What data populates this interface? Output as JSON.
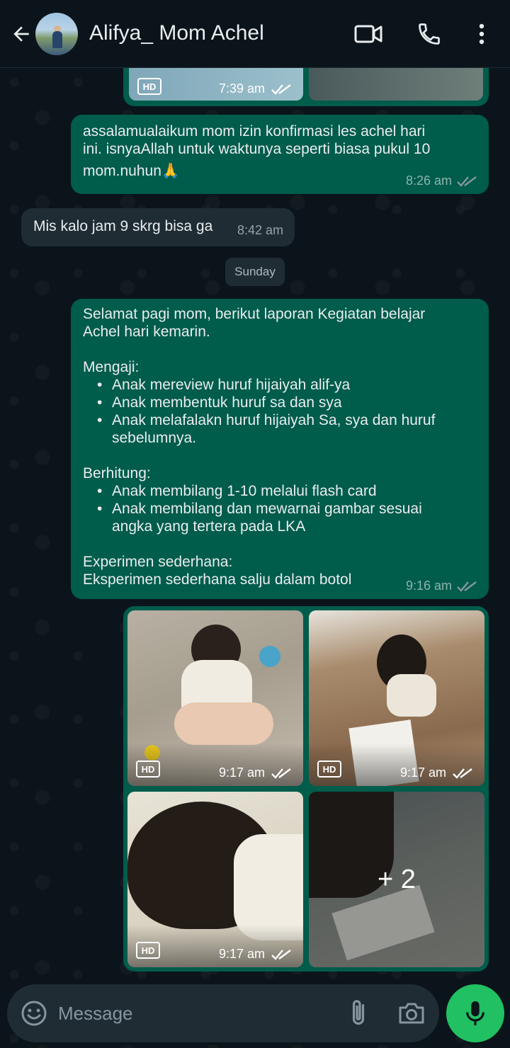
{
  "header": {
    "contact_name": "Alifya_ Mom Achel"
  },
  "messages": {
    "top_photo_time": "7:39 am",
    "msg1": {
      "line1": "assalamualaikum mom izin konfirmasi les achel hari",
      "line2": "ini. isnyaAllah untuk waktunya seperti biasa pukul 10",
      "line3": "mom.nuhun",
      "emoji": "🙏",
      "time": "8:26 am"
    },
    "msg2": {
      "text": "Mis kalo jam 9 skrg bisa ga",
      "time": "8:42 am"
    },
    "day_label": "Sunday",
    "report": {
      "intro1": "Selamat pagi mom,  berikut laporan Kegiatan belajar",
      "intro2": "Achel hari kemarin.",
      "mengaji_title": "Mengaji:",
      "mengaji_items": [
        "Anak mereview huruf hijaiyah alif-ya",
        "Anak membentuk huruf sa dan sya",
        "Anak melafalakn huruf hijaiyah Sa, sya dan huruf",
        "sebelumnya."
      ],
      "berhitung_title": "Berhitung:",
      "berhitung_items": [
        "Anak membilang 1-10 melalui flash card",
        "Anak membilang dan mewarnai gambar sesuai",
        "angka yang tertera pada LKA"
      ],
      "eksperimen_title": "Experimen sederhana:",
      "eksperimen_text": "Eksperimen sederhana salju dalam botol",
      "time": "9:16 am"
    },
    "photos": {
      "hd_label": "HD",
      "time1": "9:17 am",
      "time2": "9:17 am",
      "time3": "9:17 am",
      "more_count": "+ 2"
    }
  },
  "input": {
    "placeholder": "Message"
  },
  "colors": {
    "outgoing": "#005c4b",
    "incoming": "#1f2c34",
    "accent": "#21c063",
    "read_ticks": "#8696a0"
  },
  "icons": [
    "back-arrow-icon",
    "video-call-icon",
    "phone-icon",
    "more-vert-icon",
    "double-check-icon",
    "emoji-icon",
    "paperclip-icon",
    "camera-icon",
    "mic-icon",
    "hd-icon"
  ]
}
